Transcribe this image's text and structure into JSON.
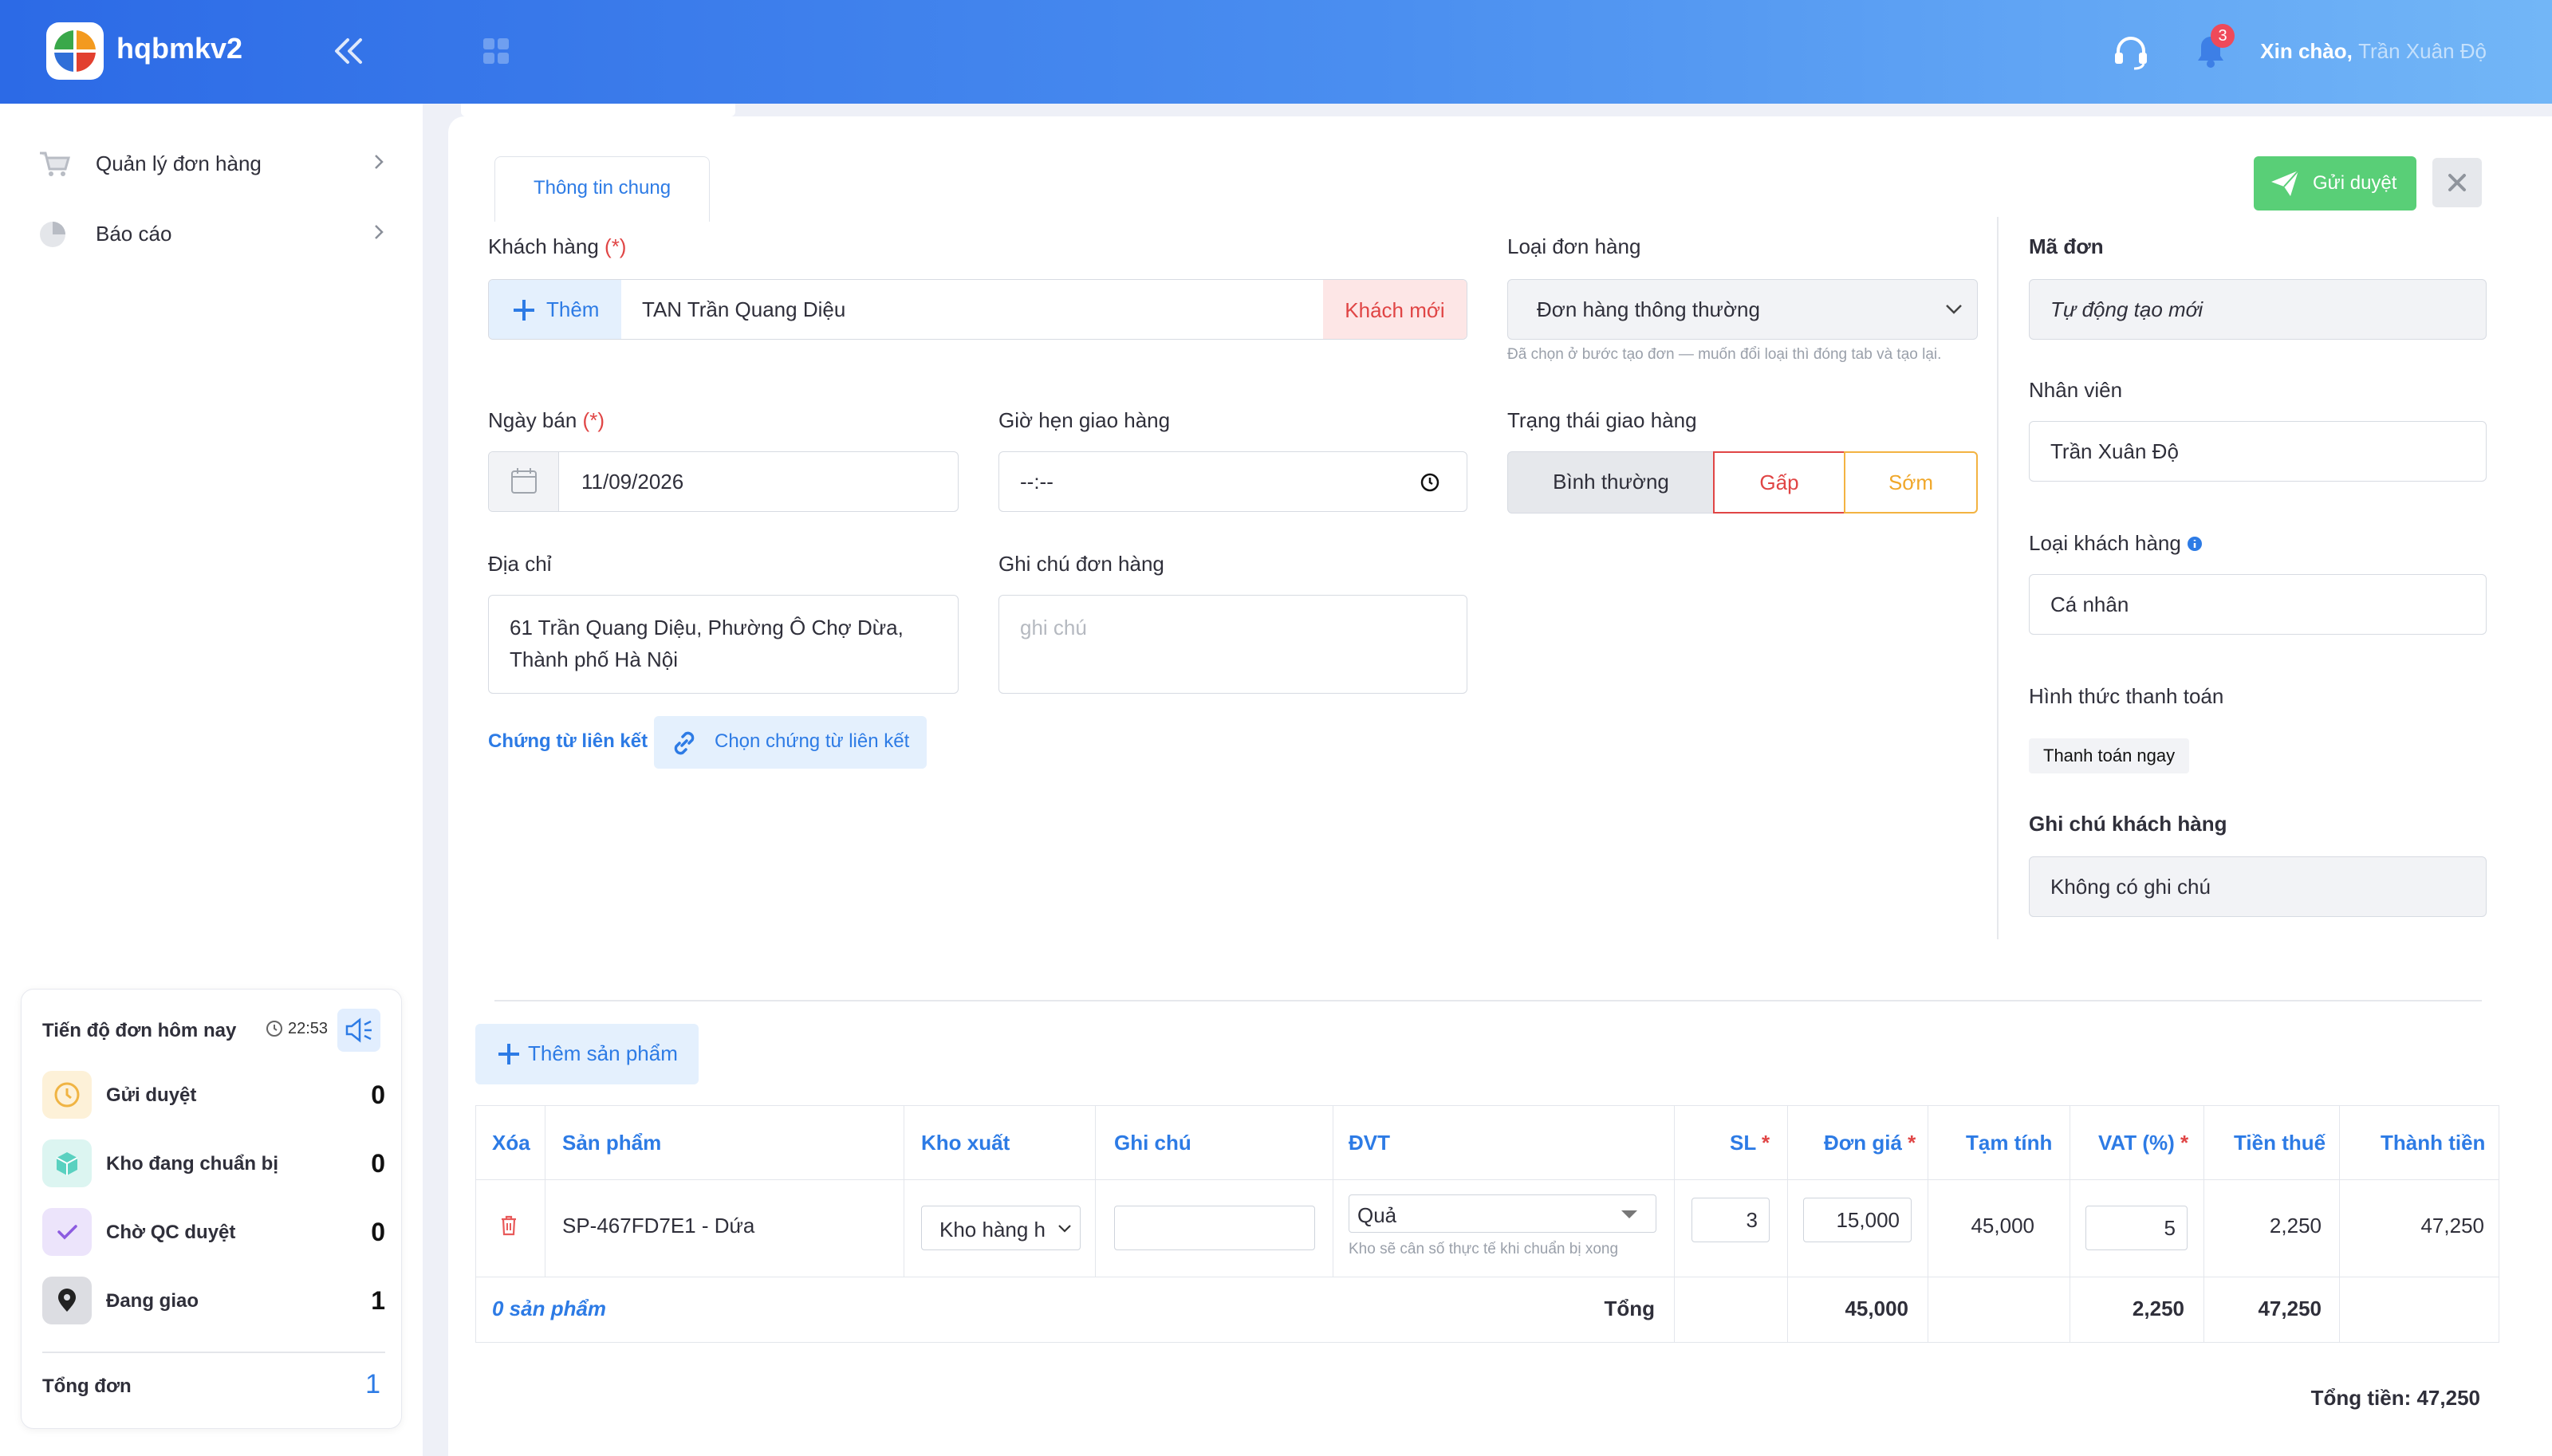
{
  "header": {
    "app_name": "hqbmkv2",
    "notif_count": "3",
    "greeting": "Xin chào,",
    "user": "Trần Xuân Độ"
  },
  "sidebar": {
    "items": [
      {
        "label": "Quản lý đơn hàng"
      },
      {
        "label": "Báo cáo"
      }
    ],
    "progress": {
      "title": "Tiến độ đơn hôm nay",
      "time": "22:53",
      "rows": [
        {
          "label": "Gửi duyệt",
          "value": "0"
        },
        {
          "label": "Kho đang chuẩn bị",
          "value": "0"
        },
        {
          "label": "Chờ QC duyệt",
          "value": "0"
        },
        {
          "label": "Đang giao",
          "value": "1"
        }
      ],
      "total_label": "Tổng đơn",
      "total_value": "1"
    }
  },
  "tab": "Thông tin chung",
  "actions": {
    "send": "Gửi duyệt"
  },
  "form": {
    "customer_label": "Khách hàng",
    "req": "(*)",
    "add": "Thêm",
    "customer": "TAN Trần Quang Diệu",
    "new_customer": "Khách mới",
    "order_type_label": "Loại đơn hàng",
    "order_type": "Đơn hàng thông thường",
    "order_type_hint": "Đã chọn ở bước tạo đơn — muốn đổi loại thì đóng tab và tạo lại.",
    "date_label": "Ngày bán",
    "date": "11/09/2026",
    "time_label": "Giờ hẹn giao hàng",
    "time": "--:--",
    "status_label": "Trạng thái giao hàng",
    "status": [
      "Bình thường",
      "Gấp",
      "Sớm"
    ],
    "address_label": "Địa chỉ",
    "address": "61 Trần Quang Diệu, Phường Ô Chợ Dừa, Thành phố Hà Nội",
    "note_label": "Ghi chú đơn hàng",
    "note_placeholder": "ghi chú",
    "doc_label": "Chứng từ liên kết",
    "doc_button": "Chọn chứng từ liên kết"
  },
  "right": {
    "code_label": "Mã đơn",
    "code": "Tự động tạo mới",
    "staff_label": "Nhân viên",
    "staff": "Trần Xuân Độ",
    "ctype_label": "Loại khách hàng",
    "ctype": "Cá nhân",
    "payment_label": "Hình thức thanh toán",
    "payment": "Thanh toán ngay",
    "cnote_label": "Ghi chú khách hàng",
    "cnote": "Không có ghi chú"
  },
  "products": {
    "add_button": "Thêm sản phẩm",
    "columns": [
      "Xóa",
      "Sản phẩm",
      "Kho xuất",
      "Ghi chú",
      "ĐVT",
      "SL",
      "Đơn giá",
      "Tạm tính",
      "VAT (%)",
      "Tiền thuế",
      "Thành tiền"
    ],
    "star": "*",
    "row": {
      "product": "SP-467FD7E1 - Dứa",
      "warehouse": "Kho hàng h",
      "note": "",
      "unit": "Quả",
      "unit_hint": "Kho sẽ cân số thực tế khi chuẩn bị xong",
      "qty": "3",
      "price": "15,000",
      "subtotal": "45,000",
      "vat": "5",
      "tax": "2,250",
      "total": "47,250"
    },
    "footer": {
      "count": "0 sản phẩm",
      "label": "Tổng",
      "subtotal": "45,000",
      "tax": "2,250",
      "total": "47,250"
    },
    "grand_total": "Tổng tiền: 47,250"
  }
}
